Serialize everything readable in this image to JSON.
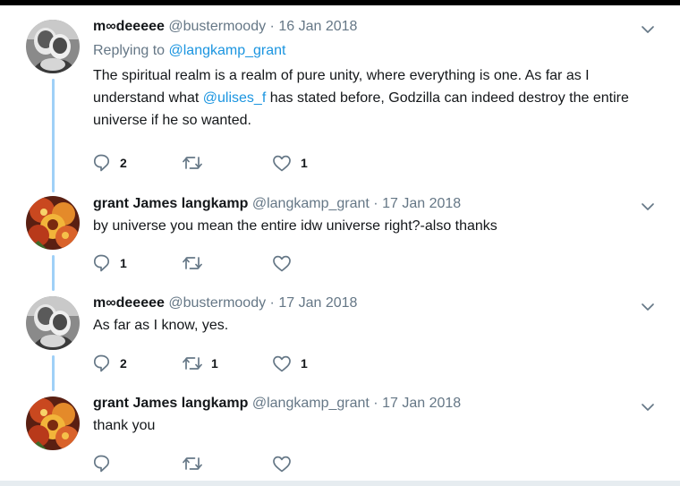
{
  "tweets": [
    {
      "avatar": "avatar-grayscale-photo",
      "name": "m∞deeeee",
      "handle": "@bustermoody",
      "separator": "·",
      "date": "16 Jan 2018",
      "replying_prefix": "Replying to",
      "replying_to": "@langkamp_grant",
      "text_1": "The spiritual realm is a realm of pure unity, where everything is one. As far as I understand what",
      "mention": "@ulises_f",
      "text_2": "has stated before, Godzilla can indeed destroy the entire universe if he so wanted.",
      "replies": "2",
      "retweets": "",
      "likes": "1"
    },
    {
      "avatar": "avatar-flower-photo",
      "name": "grant James langkamp",
      "handle": "@langkamp_grant",
      "separator": "·",
      "date": "17 Jan 2018",
      "text": "by universe you mean the entire idw universe right?-also thanks",
      "replies": "1",
      "retweets": "",
      "likes": ""
    },
    {
      "avatar": "avatar-grayscale-photo",
      "name": "m∞deeeee",
      "handle": "@bustermoody",
      "separator": "·",
      "date": "17 Jan 2018",
      "text": "As far as I know, yes.",
      "replies": "2",
      "retweets": "1",
      "likes": "1"
    },
    {
      "avatar": "avatar-flower-photo",
      "name": "grant James langkamp",
      "handle": "@langkamp_grant",
      "separator": "·",
      "date": "17 Jan 2018",
      "text": "thank you",
      "replies": "",
      "retweets": "",
      "likes": ""
    }
  ],
  "icons": {
    "reply": "reply-icon",
    "retweet": "retweet-icon",
    "like": "heart-icon",
    "menu": "chevron-down-icon"
  },
  "colors": {
    "name": "#14171a",
    "meta": "#657786",
    "link": "#1b95e0",
    "thread_line": "#9fd0f7",
    "icon": "#657786"
  }
}
